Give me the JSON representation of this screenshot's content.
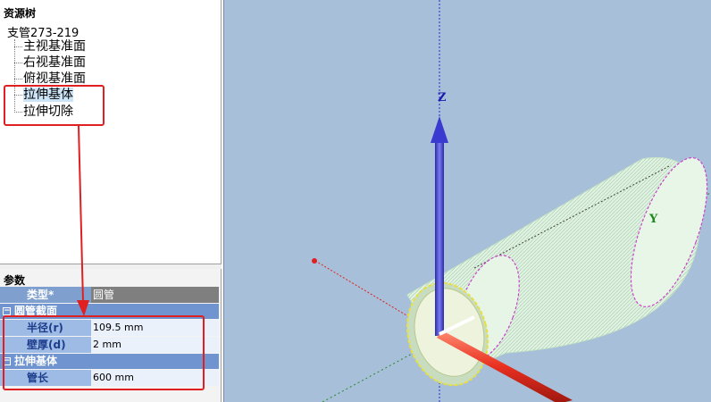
{
  "resource_tree": {
    "title": "资源树",
    "root": "支管273-219",
    "items": [
      {
        "label": "主视基准面"
      },
      {
        "label": "右视基准面"
      },
      {
        "label": "俯视基准面"
      },
      {
        "label": "拉伸基体"
      },
      {
        "label": "拉伸切除"
      }
    ]
  },
  "params": {
    "title": "参数",
    "type_row": {
      "key": "类型*",
      "value": "圆管"
    },
    "group1": {
      "toggle": "−",
      "title": "圆管截面"
    },
    "radius": {
      "key": "半径(r)",
      "value": "109.5 mm"
    },
    "thickness": {
      "key": "壁厚(d)",
      "value": "2 mm"
    },
    "group2": {
      "toggle": "−",
      "title": "拉伸基体"
    },
    "length": {
      "key": "管长",
      "value": "600 mm"
    }
  },
  "viewport": {
    "axis_z": "Z",
    "axis_y": "Y",
    "colors": {
      "background": "#a7bfd8",
      "z_axis": "#3a3ad0",
      "x_axis": "#e83020",
      "pipe": "#dff4df",
      "annotation": "#e02020"
    }
  }
}
